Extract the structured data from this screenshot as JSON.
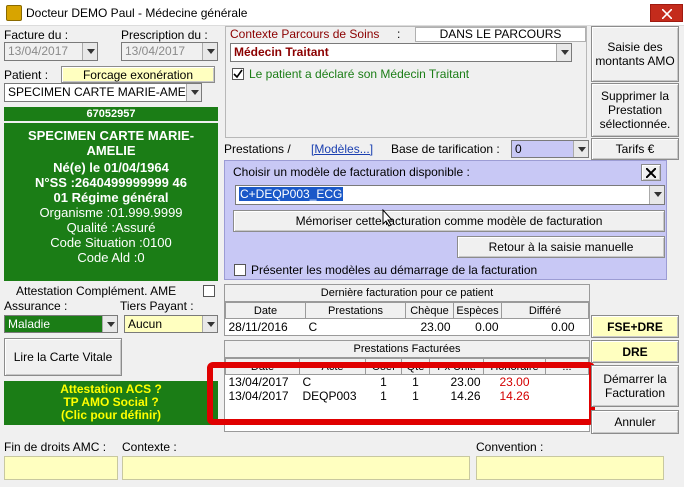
{
  "window": {
    "title": "Docteur DEMO Paul - Médecine générale"
  },
  "left": {
    "facture_label": "Facture du :",
    "facture_date": "13/04/2017",
    "prescription_label": "Prescription du :",
    "prescription_date": "13/04/2017",
    "patient_label": "Patient :",
    "forcage_button": "Forcage exonération",
    "patient_select": "SPECIMEN CARTE MARIE-AMELIE",
    "patient_number": "67052957",
    "card": {
      "name": "SPECIMEN CARTE MARIE-AMELIE",
      "birth": "Né(e) le 01/04/1964",
      "nss": "N°SS :2640499999999 46",
      "regime": "01 Régime général",
      "organisme": "Organisme :01.999.9999",
      "qualite": "Qualité :Assuré",
      "code_situation": "Code Situation :0100",
      "code_ald": "Code Ald :0"
    },
    "attestation_label": "Attestation Complément. AME",
    "assurance_label": "Assurance :",
    "assurance_value": "Maladie",
    "tiers_label": "Tiers Payant :",
    "tiers_value": "Aucun",
    "carte_vitale_button": "Lire la Carte Vitale",
    "acs": [
      "Attestation ACS ?",
      "TP AMO Social ?",
      "(Clic pour définir)"
    ]
  },
  "contexte": {
    "label": "Contexte Parcours de Soins",
    "dans_parcours": "DANS LE PARCOURS",
    "medecin_value": "Médecin Traitant",
    "declared_label": "Le patient a déclaré son Médecin Traitant"
  },
  "right_buttons": {
    "saisie_montants": "Saisie des montants AMO",
    "supprimer": "Supprimer la Prestation sélectionnée.",
    "tarifs": "Tarifs €",
    "fse_dre": "FSE+DRE",
    "dre": "DRE",
    "demarrer": "Démarrer la Facturation",
    "annuler": "Annuler"
  },
  "prestations_bar": {
    "label": "Prestations /",
    "modeles_link": "[Modèles...]",
    "base_label": "Base de tarification :",
    "base_value": "0"
  },
  "models": {
    "choose_label": "Choisir un modèle de facturation disponible :",
    "selected_model": "C+DEQP003_ECG",
    "memoriser_button": "Mémoriser cette facturation comme modèle de facturation",
    "retour_button": "Retour à la saisie manuelle",
    "presenter_label": "Présenter les modèles au démarrage de la facturation"
  },
  "last_invoice": {
    "title": "Dernière facturation pour ce patient",
    "columns": [
      "Date",
      "Prestations",
      "Chèque",
      "Espèces",
      "Différé"
    ],
    "row": [
      "28/11/2016",
      "C",
      "23.00",
      "0.00",
      "0.00"
    ]
  },
  "billed": {
    "title": "Prestations Facturées",
    "columns": [
      "Date",
      "Acte",
      "Coef",
      "Qte",
      "Px Unit.",
      "Honoraire",
      "..."
    ],
    "rows": [
      [
        "13/04/2017",
        "C",
        "1",
        "1",
        "23.00",
        "23.00"
      ],
      [
        "13/04/2017",
        "DEQP003",
        "1",
        "1",
        "14.26",
        "14.26"
      ]
    ]
  },
  "footer": {
    "fin_droits_label": "Fin de droits AMC :",
    "contexte_label": "Contexte :",
    "convention_label": "Convention :"
  },
  "colors": {
    "accent_green": "#1b7d16",
    "highlight_red": "#e00000",
    "models_bg": "#c8c8f5"
  }
}
